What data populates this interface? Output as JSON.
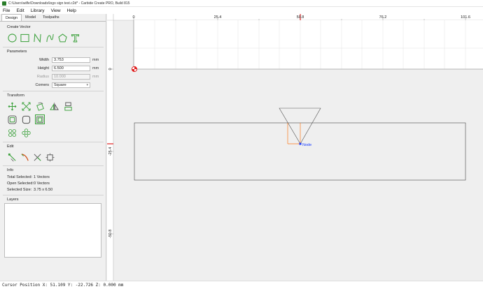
{
  "window": {
    "title": "C:\\Users\\wilfe\\Downloads\\logo sign test.c2d* - Carbide Create PRO, Build 815"
  },
  "menu": [
    {
      "label": "File",
      "key": "F"
    },
    {
      "label": "Edit",
      "key": "E"
    },
    {
      "label": "Library",
      "key": "L"
    },
    {
      "label": "View",
      "key": "V"
    },
    {
      "label": "Help",
      "key": "H"
    }
  ],
  "tabs": {
    "design": "Design",
    "model": "Model",
    "toolpaths": "Toolpaths"
  },
  "create_vector": {
    "title": "Create Vector",
    "tools": [
      "circle-icon",
      "rectangle-icon",
      "polyline-icon",
      "curve-icon",
      "polygon-icon",
      "text-icon"
    ]
  },
  "parameters": {
    "title": "Parameters",
    "width_label": "Width",
    "width_value": "3.753",
    "width_unit": "mm",
    "height_label": "Height",
    "height_value": "6.500",
    "height_unit": "mm",
    "radius_label": "Radius",
    "radius_value": "10.000",
    "radius_unit": "mm",
    "corners_label": "Corners",
    "corners_value": "Square"
  },
  "transform": {
    "title": "Transform",
    "row1": [
      "move-icon",
      "scale-icon",
      "rotate-icon",
      "mirror-icon",
      "align-icon"
    ],
    "row2": [
      "offset-icon",
      "fillet-icon",
      "boolean-icon"
    ],
    "row3": [
      "circle-array-icon",
      "grid-array-icon"
    ]
  },
  "edit": {
    "title": "Edit",
    "tools": [
      "node-edit-icon",
      "knife-icon",
      "trim-icon",
      "bounding-box-icon"
    ]
  },
  "info": {
    "title": "Info",
    "total_label": "Total Selected:",
    "total_value": "1 Vectors",
    "open_label": "Open Selected:",
    "open_value": "0 Vectors",
    "size_label": "Selected Size:",
    "size_value": "3.75 x 6.50"
  },
  "layers": {
    "title": "Layers"
  },
  "ruler": {
    "x_ticks": [
      "0",
      "25.4",
      "50.8",
      "76.2",
      "101.6"
    ],
    "y_ticks": [
      "0",
      "-25.4",
      "-50.8"
    ]
  },
  "canvas": {
    "node_label": "Node"
  },
  "status": {
    "cursor": "Cursor Position X: 51.109 Y: -22.726 Z: 0.000 mm"
  },
  "colors": {
    "accent_green": "#3aa03a",
    "selection_orange": "#ff7a1a",
    "node_blue": "#1a3cff",
    "origin_red": "#e02020"
  }
}
